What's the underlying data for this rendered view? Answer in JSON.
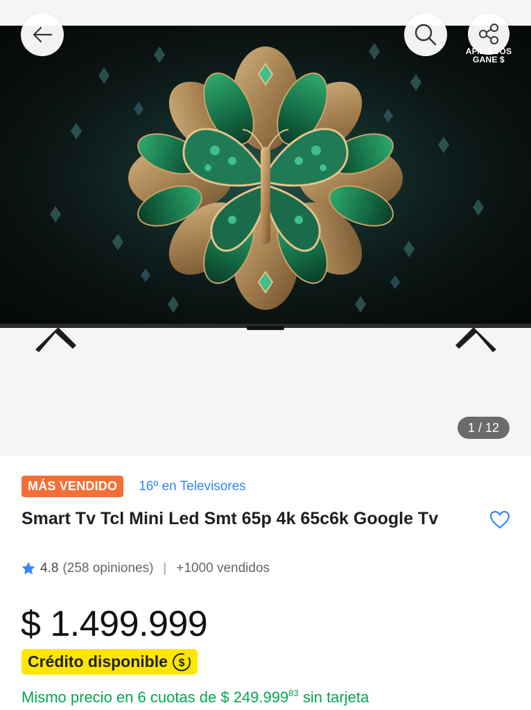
{
  "gallery": {
    "counter": "1 / 12",
    "affiliate_line1": "AFILIADOS",
    "affiliate_line2": "GANE $"
  },
  "product": {
    "badge": "MÁS VENDIDO",
    "ranking": "16º en Televisores",
    "title": "Smart Tv Tcl Mini Led Smt 65p 4k 65c6k Google Tv",
    "rating": "4.8",
    "reviews": "(258 opiniones)",
    "separator": "|",
    "sold": "+1000 vendidos",
    "price": "$ 1.499.999",
    "credit_label": "Crédito disponible",
    "installments_prefix": "Mismo precio en 6 cuotas de $ 249.999",
    "installments_cents": "83",
    "installments_suffix": " sin tarjeta"
  },
  "icons": {
    "back": "arrow-left-icon",
    "search": "search-icon",
    "share": "share-icon",
    "favorite": "heart-icon",
    "rating": "star-icon",
    "credit": "dollar-coin-icon"
  },
  "colors": {
    "badge_bg": "#f36f36",
    "link_blue": "#3483fa",
    "credit_bg": "#ffe600",
    "installments_green": "#00a650",
    "counter_bg": "#6b6b6b"
  }
}
